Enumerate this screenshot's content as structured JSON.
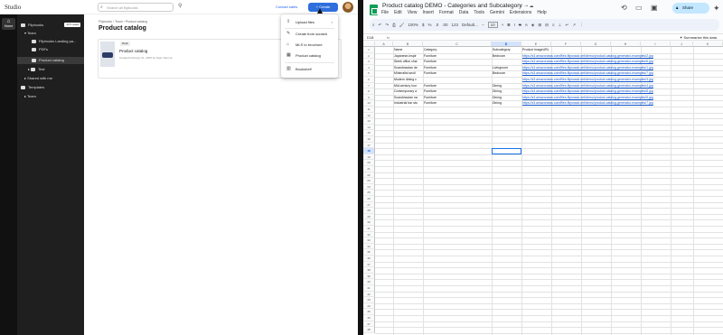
{
  "studio": {
    "logo": "Studio",
    "search_placeholder": "Search all flipbooks",
    "contact_sales": "Contact sales",
    "create_label": "+ Create",
    "rail_home": "Home",
    "sidebar": {
      "flipbooks": "Flipbooks",
      "flipbooks_count": "17/∞ used",
      "team": "Team",
      "items": [
        "Flipbooks Landing pa...",
        "PDFs",
        "Product catalog",
        "Test"
      ],
      "shared": "Shared with me",
      "templates": "Templates",
      "team2": "Team"
    },
    "breadcrumb": [
      "Flipbooks",
      "Team",
      "Product catalog"
    ],
    "page_title": "Product catalog",
    "card": {
      "pill": "Draft",
      "title": "Product catalog",
      "meta": "Created February 21, 2025 by Sean Stroma"
    },
    "menu": [
      {
        "label": "Upload files",
        "icon": "⇪"
      },
      {
        "label": "Create from scratch",
        "icon": "✎"
      },
      {
        "label": "MLS to brochure",
        "icon": "⌂"
      },
      {
        "label": "Product catalog",
        "icon": "▦"
      },
      {
        "label": "Bookshelf",
        "icon": "▥"
      }
    ]
  },
  "sheets": {
    "title": "Product catalog DEMO - Categories and Subcategory",
    "menus": [
      "File",
      "Edit",
      "View",
      "Insert",
      "Format",
      "Data",
      "Tools",
      "Gemini",
      "Extensions",
      "Help"
    ],
    "share": "Share",
    "toolbar": {
      "zoom": "100%",
      "currency": "$",
      "percent": "%",
      "num": "123",
      "font": "Default...",
      "size": "10"
    },
    "name_box": "D18",
    "fx": "fx",
    "summarize": "Summarize this data",
    "columns": [
      "A",
      "B",
      "C",
      "D",
      "E",
      "F",
      "G",
      "H",
      "I",
      "J",
      "K"
    ],
    "headers": [
      "Name",
      "Category",
      "Subcategory",
      "Product imageURL"
    ],
    "rows": [
      [
        "Japanese-inspir",
        "Furniture",
        "Bedroom",
        "https://s3.amazonaws.com/files.flipsnack.net/demo/product-catalog-generator-examples/2.jpg"
      ],
      [
        "Sleek office chai",
        "Furniture",
        "",
        "https://s3.amazonaws.com/files.flipsnack.net/demo/product-catalog-generator-examples/6.jpg"
      ],
      [
        "Scandinavian de",
        "Furniture",
        "Livingroom",
        "https://s3.amazonaws.com/files.flipsnack.net/demo/product-catalog-generator-examples/1.jpg"
      ],
      [
        "Minimalist secti",
        "Furniture",
        "Bedroom",
        "https://s3.amazonaws.com/files.flipsnack.net/demo/product-catalog-generator-examples/7.jpg"
      ],
      [
        "Modern dining c",
        "",
        "",
        "https://s3.amazonaws.com/files.flipsnack.net/demo/product-catalog-generator-examples/3.jpg"
      ],
      [
        "Mid-century lour",
        "Furniture",
        "Dining",
        "https://s3.amazonaws.com/files.flipsnack.net/demo/product-catalog-generator-examples/4.jpg"
      ],
      [
        "Contemporary a",
        "Furniture",
        "Dining",
        "https://s3.amazonaws.com/files.flipsnack.net/demo/product-catalog-generator-examples/8.jpg"
      ],
      [
        "Scandinavian na",
        "Furniture",
        "Dining",
        "https://s3.amazonaws.com/files.flipsnack.net/demo/product-catalog-generator-examples/5.jpg"
      ],
      [
        "Industrial bar sto",
        "Furniture",
        "Dining",
        "https://s3.amazonaws.com/files.flipsnack.net/demo/product-catalog-generator-examples/7.jpg"
      ]
    ],
    "row_count": 48
  }
}
